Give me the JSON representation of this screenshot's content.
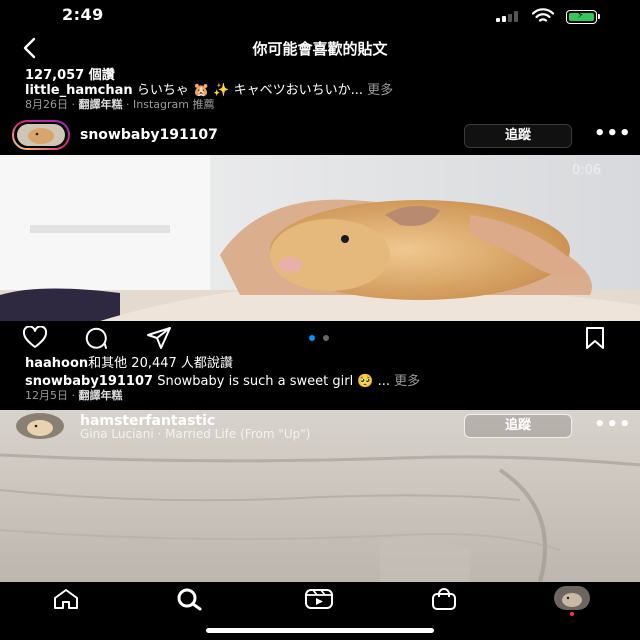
{
  "status_bar": {
    "time": "2:49"
  },
  "nav": {
    "title": "你可能會喜歡的貼文",
    "back_icon": "chevron-left-icon"
  },
  "prev_post": {
    "likes": "127,057 個讚",
    "username": "little_hamchan",
    "caption": " らいちゃ 🐹 ✨ キャベツおいちいか...",
    "more": "更多",
    "date": "8月26日",
    "separator": " · ",
    "translate": "翻譯年糕",
    "source": "Instagram 推薦"
  },
  "post1": {
    "username": "snowbaby191107",
    "follow_label": "追蹤",
    "more_label": "•••",
    "video_time": "0:06",
    "liked_by_user": "haahoon",
    "liked_by_rest": "和其他 20,447 人都說讚",
    "caption_user": "snowbaby191107",
    "caption": " Snowbaby is such a sweet girl 🥺 ...",
    "more": "更多",
    "date": "12月5日",
    "separator": " · ",
    "translate": "翻譯年糕"
  },
  "post2": {
    "username": "hamsterfantastic",
    "audio": "Gina Luciani · Married Life (From \"Up\")",
    "follow_label": "追蹤",
    "more_label": "•••"
  },
  "tabbar": {
    "items": [
      "home-icon",
      "search-icon",
      "reels-icon",
      "shop-icon",
      "profile-avatar"
    ]
  },
  "colors": {
    "background": "#000000",
    "text": "#ffffff",
    "secondary": "#9a9a9a",
    "accent": "#0095f6"
  }
}
